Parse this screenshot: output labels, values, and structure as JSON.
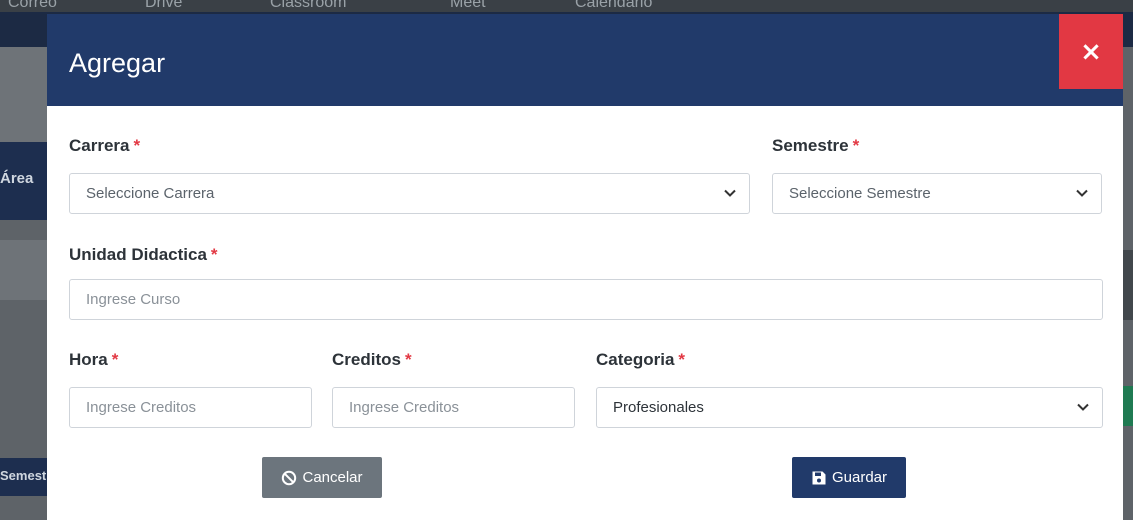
{
  "modal": {
    "title": "Agregar",
    "close_label": "×"
  },
  "form": {
    "required_mark": "*",
    "carrera": {
      "label": "Carrera",
      "value": "Seleccione Carrera"
    },
    "semestre": {
      "label": "Semestre",
      "value": "Seleccione Semestre"
    },
    "unidad": {
      "label": "Unidad Didactica",
      "placeholder": "Ingrese Curso"
    },
    "hora": {
      "label": "Hora",
      "placeholder": "Ingrese Creditos"
    },
    "creditos": {
      "label": "Creditos",
      "placeholder": "Ingrese Creditos"
    },
    "categoria": {
      "label": "Categoria",
      "value": "Profesionales"
    }
  },
  "buttons": {
    "cancel": "Cancelar",
    "save": "Guardar"
  },
  "background": {
    "bookmarks": [
      "Correo",
      "Drive",
      "Classroom",
      "Meet",
      "Calendario"
    ],
    "side_label": "Área",
    "side_label_2": "Semest"
  },
  "colors": {
    "header": "#213a6a",
    "close": "#e23843",
    "required": "#e23843",
    "cancel_button": "#6c757d",
    "save_button": "#213a6a"
  },
  "icons": {
    "close": "close-icon",
    "cancel": "ban-icon",
    "save": "floppy-disk-icon",
    "dropdown": "chevron-down-icon"
  }
}
